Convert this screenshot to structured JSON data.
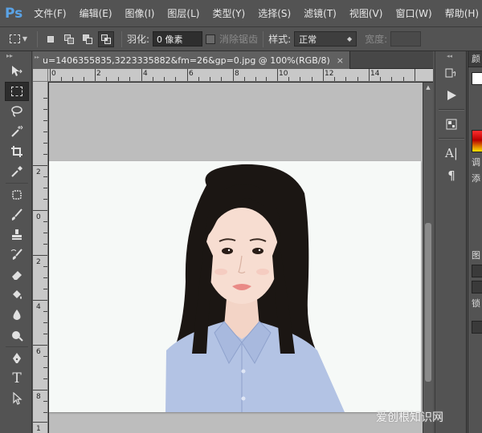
{
  "app": {
    "logo": "Ps"
  },
  "menu": [
    {
      "label": "文件(F)"
    },
    {
      "label": "编辑(E)"
    },
    {
      "label": "图像(I)"
    },
    {
      "label": "图层(L)"
    },
    {
      "label": "类型(Y)"
    },
    {
      "label": "选择(S)"
    },
    {
      "label": "滤镜(T)"
    },
    {
      "label": "视图(V)"
    },
    {
      "label": "窗口(W)"
    },
    {
      "label": "帮助(H)"
    }
  ],
  "options": {
    "feather_label": "羽化:",
    "feather_value": "0 像素",
    "antialias_label": "消除锯齿",
    "style_label": "样式:",
    "style_value": "正常",
    "width_label": "宽度:"
  },
  "document": {
    "tab_title": "u=1406355835,3223335882&fm=26&gp=0.jpg @ 100%(RGB/8)",
    "tab_close": "×",
    "ruler_top": [
      "0",
      "2",
      "4",
      "6",
      "8",
      "10",
      "12",
      "14"
    ],
    "ruler_left": [
      "2",
      "0",
      "2",
      "4",
      "6",
      "8",
      "1"
    ]
  },
  "right_panel": {
    "header": "颜",
    "text_1": "调",
    "text_2": "添",
    "text_3": "图",
    "text_4": "锁"
  },
  "watermark": "爱创根知识网",
  "colors": {
    "ui_bg": "#535353",
    "canvas_bg": "#bdbdbd",
    "photo_bg": "#f6f9f7",
    "shirt": "#b3c3e4",
    "hair": "#1b1613",
    "logo": "#5aa3e6"
  }
}
